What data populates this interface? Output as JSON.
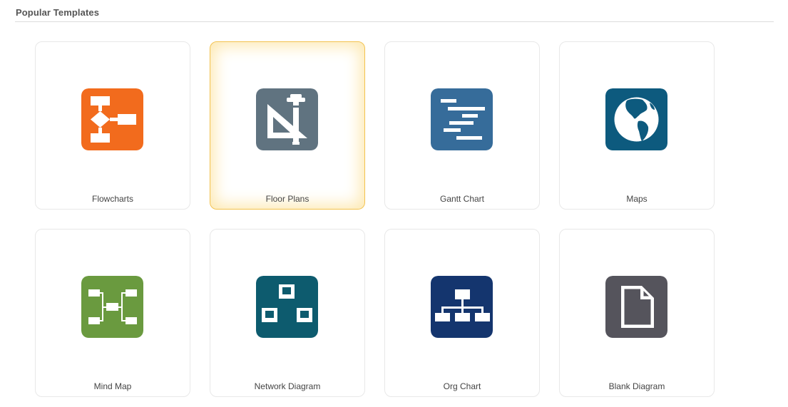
{
  "section": {
    "title": "Popular Templates"
  },
  "templates": [
    {
      "label": "Flowcharts",
      "icon": "flowchart-icon",
      "color": "#F26B1D",
      "selected": false
    },
    {
      "label": "Floor Plans",
      "icon": "floor-plan-icon",
      "color": "#607380",
      "selected": true
    },
    {
      "label": "Gantt Chart",
      "icon": "gantt-chart-icon",
      "color": "#366C9A",
      "selected": false
    },
    {
      "label": "Maps",
      "icon": "globe-icon",
      "color": "#0D5A7E",
      "selected": false
    },
    {
      "label": "Mind Map",
      "icon": "mind-map-icon",
      "color": "#6A9A3F",
      "selected": false
    },
    {
      "label": "Network Diagram",
      "icon": "network-diagram-icon",
      "color": "#0D5B6E",
      "selected": false
    },
    {
      "label": "Org Chart",
      "icon": "org-chart-icon",
      "color": "#14356E",
      "selected": false
    },
    {
      "label": "Blank Diagram",
      "icon": "blank-document-icon",
      "color": "#55545C",
      "selected": false
    }
  ],
  "colors": {
    "selected_border": "#F3C24E",
    "selected_glow": "#FDE9B3"
  }
}
